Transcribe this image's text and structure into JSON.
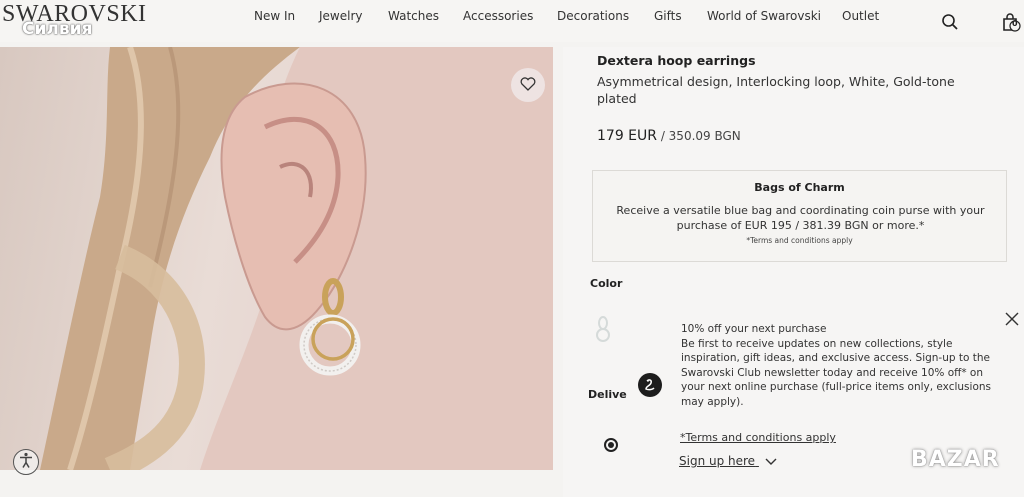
{
  "header": {
    "logo": "SWAROVSKI",
    "watermark": "Силвия",
    "nav": [
      "New In",
      "Jewelry",
      "Watches",
      "Accessories",
      "Decorations",
      "Gifts",
      "World of Swarovski",
      "Outlet"
    ],
    "cart_count": "0"
  },
  "product": {
    "title": "Dexterа hoop earrings",
    "subtitle": "Asymmetrical design, Interlocking loop, White, Gold-tone plated",
    "price_main": "179 EUR",
    "price_alt": " / 350.09 BGN"
  },
  "promo": {
    "title": "Bags of Charm",
    "text": "Receive a versatile blue bag and coordinating coin purse with your purchase of EUR 195 / 381.39 BGN or more.*",
    "note": "*Terms and conditions apply"
  },
  "options": {
    "color_label": "Color",
    "delivery_label": "Delive"
  },
  "newsletter": {
    "headline": "10% off your next purchase",
    "body": "Be first to receive updates on new collections, style inspiration, gift ideas, and exclusive access. Sign-up to the Swarovski Club newsletter today and receive 10% off* on your next online purchase (full-price items only, exclusions may apply).",
    "terms_link": "*Terms and conditions apply",
    "signup_link": "Sign up here"
  },
  "overlay": {
    "bazar_logo": "BAZAR"
  },
  "icons": [
    "search-icon",
    "bag-icon",
    "heart-icon",
    "close-icon",
    "swan-icon",
    "chevron-down-icon",
    "accessibility-icon"
  ],
  "colors": {
    "gold": "#c9a25a",
    "accent_dark": "#1d1d1d"
  }
}
